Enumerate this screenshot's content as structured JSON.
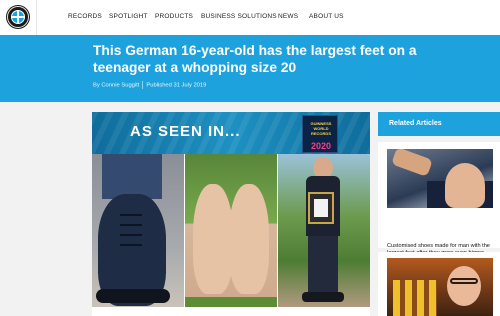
{
  "nav": {
    "logo_icon": "guinness-world-records-globe-logo",
    "items": [
      "RECORDS",
      "SPOTLIGHT",
      "PRODUCTS",
      "BUSINESS SOLUTIONS",
      "NEWS",
      "ABOUT US"
    ]
  },
  "article": {
    "title": "This German 16-year-old has the largest feet on a teenager at a whopping size 20",
    "author": "By Connie Suggitt",
    "published": "Published 31 July 2019"
  },
  "banner": {
    "as_seen_in": "AS SEEN IN...",
    "book_title": "GUINNESS WORLD RECORDS",
    "book_year": "2020"
  },
  "sidebar": {
    "heading": "Related Articles",
    "articles": [
      {
        "title": "Customised shoes made for man with the largest feet after they grow even bigger"
      }
    ]
  },
  "colors": {
    "brand_blue": "#1ea2de",
    "nav_bg": "#ffffff",
    "page_bg": "#f2f2f2"
  }
}
